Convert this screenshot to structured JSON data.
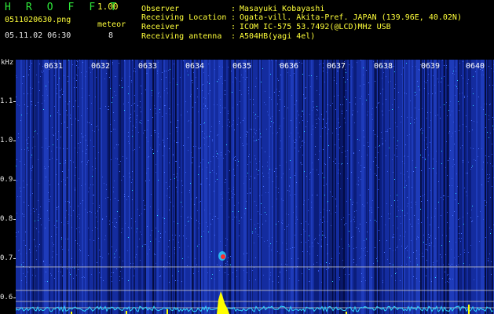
{
  "header": {
    "app_title": "H R O F F T",
    "version": "1.00",
    "file_name": "0511020630.png",
    "date_time": "05.11.02 06:30",
    "meteor_label": "meteor",
    "meteor_count": "8"
  },
  "info": [
    {
      "label": "Observer",
      "colon": ":",
      "value": "Masayuki Kobayashi"
    },
    {
      "label": "Receiving Location",
      "colon": ":",
      "value": "Ogata-vill. Akita-Pref. JAPAN (139.96E, 40.02N)"
    },
    {
      "label": "Receiver",
      "colon": ":",
      "value": "ICOM IC-575 53.7492(@LCD)MHz USB"
    },
    {
      "label": "Receiving antenna",
      "colon": ":",
      "value": "A504HB(yagi 4el)"
    }
  ],
  "y_axis": {
    "unit": "kHz",
    "ticks": [
      "1.1",
      "1.0",
      "0.9",
      "0.8",
      "0.7",
      "0.6"
    ]
  },
  "x_axis": {
    "time_ticks": [
      "0631",
      "0632",
      "0633",
      "0634",
      "0635",
      "0636",
      "0637",
      "0638",
      "0639",
      "0640"
    ]
  },
  "colors": {
    "background": "#000000",
    "spectrogram_base": "#0a1a6c",
    "header_green": "#2ee83a",
    "header_yellow": "#ffff3a",
    "noise_cyan": "#2fd6ff",
    "meteor_yellow": "#ffff00",
    "meteor_red": "#ff2a2a"
  }
}
